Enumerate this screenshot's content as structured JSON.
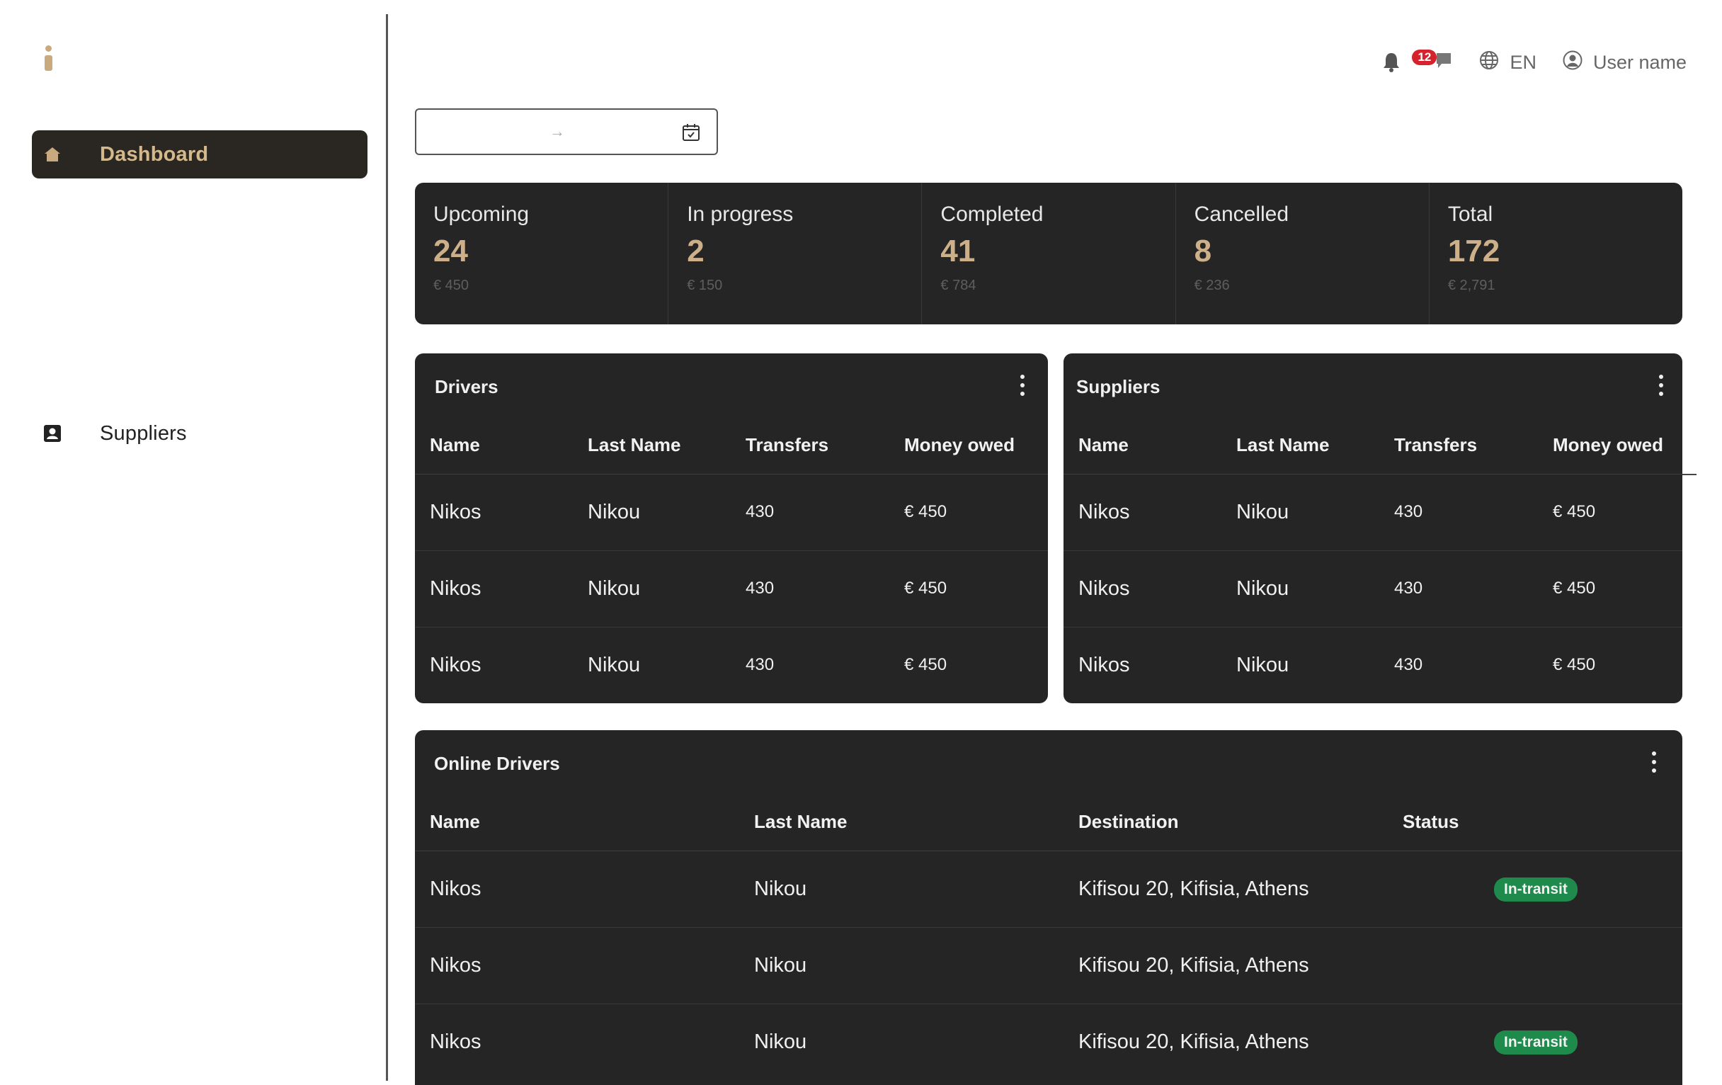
{
  "sidebar": {
    "logo_icon": "info-letter-i",
    "items": [
      {
        "label": "Dashboard",
        "icon": "home-icon",
        "active": true
      },
      {
        "label": "Suppliers",
        "icon": "contact-card-icon",
        "active": false
      }
    ]
  },
  "header": {
    "notifications_count": "12",
    "language": "EN",
    "user_name": "User name"
  },
  "date_range": {
    "start": "",
    "end": "",
    "separator_icon": "arrow-right-icon",
    "calendar_icon": "calendar-icon"
  },
  "stats": [
    {
      "label": "Upcoming",
      "count": "24",
      "amount": "€ 450"
    },
    {
      "label": "In progress",
      "count": "2",
      "amount": "€ 150"
    },
    {
      "label": "Completed",
      "count": "41",
      "amount": "€ 784"
    },
    {
      "label": "Cancelled",
      "count": "8",
      "amount": "€ 236"
    },
    {
      "label": "Total",
      "count": "172",
      "amount": "€ 2,791"
    }
  ],
  "drivers": {
    "title": "Drivers",
    "columns": [
      "Name",
      "Last Name",
      "Transfers",
      "Money owed"
    ],
    "rows": [
      [
        "Nikos",
        "Nikou",
        "430",
        "€ 450"
      ],
      [
        "Nikos",
        "Nikou",
        "430",
        "€ 450"
      ],
      [
        "Nikos",
        "Nikou",
        "430",
        "€ 450"
      ]
    ]
  },
  "suppliers": {
    "title": "Suppliers",
    "columns": [
      "Name",
      "Last Name",
      "Transfers",
      "Money owed"
    ],
    "rows": [
      [
        "Nikos",
        "Nikou",
        "430",
        "€ 450"
      ],
      [
        "Nikos",
        "Nikou",
        "430",
        "€ 450"
      ],
      [
        "Nikos",
        "Nikou",
        "430",
        "€ 450"
      ]
    ]
  },
  "online_drivers": {
    "title": "Online Drivers",
    "columns": [
      "Name",
      "Last Name",
      "Destination",
      "Status"
    ],
    "rows": [
      [
        "Nikos",
        "Nikou",
        "Kifisou 20, Kifisia, Athens",
        "In-transit"
      ],
      [
        "Nikos",
        "Nikou",
        "Kifisou 20, Kifisia, Athens",
        ""
      ],
      [
        "Nikos",
        "Nikou",
        "Kifisou 20, Kifisia, Athens",
        "In-transit"
      ]
    ]
  },
  "colors": {
    "accent": "#cdb089",
    "panel": "#252525",
    "status_green": "#1e8a4c",
    "badge_red": "#d6222c"
  }
}
